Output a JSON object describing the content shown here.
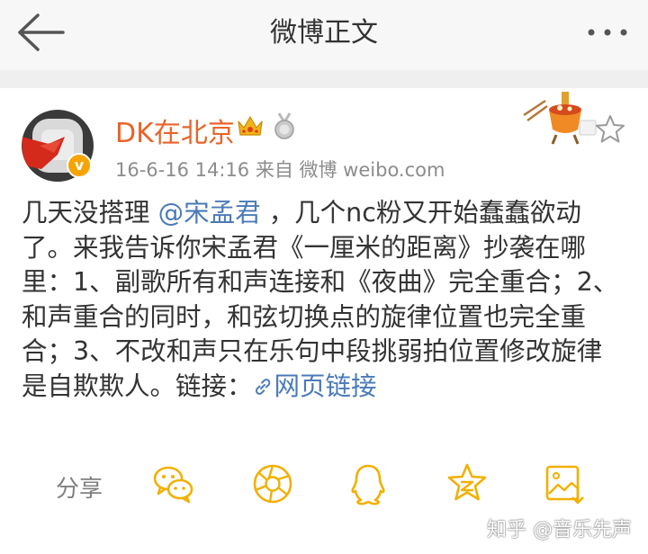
{
  "header": {
    "title": "微博正文",
    "back_icon": "arrow-left-icon",
    "more_icon": "more-dots-icon"
  },
  "post": {
    "author": {
      "name": "DK在北京",
      "verified_badge": "v",
      "badges": [
        "crown-icon",
        "medal-icon"
      ]
    },
    "meta": "16-6-16 14:16  来自 微博 weibo.com",
    "content": {
      "p1": "几天没搭理 ",
      "mention": "@宋孟君",
      "p2": " ，几个nc粉又开始蠢蠢欲动了。来我告诉你宋孟君《一厘米的距离》抄袭在哪里：1、副歌所有和声连接和《夜曲》完全重合；2、和声重合的同时，和弦切换点的旋律位置也完全重合；3、不改和声只在乐句中段挑弱拍位置修改旋律是自欺欺人。链接：",
      "link_text": "网页链接"
    }
  },
  "share": {
    "label": "分享",
    "targets": [
      "wechat-icon",
      "moments-icon",
      "qq-icon",
      "qzone-icon",
      "save-image-icon"
    ]
  },
  "watermark": "知乎 @音乐先声",
  "colors": {
    "username": "#e8642a",
    "link": "#4a7ab8",
    "share_icons": "#f1b000",
    "meta": "#8c8c8c",
    "header_bg": "#f7f7f7"
  }
}
